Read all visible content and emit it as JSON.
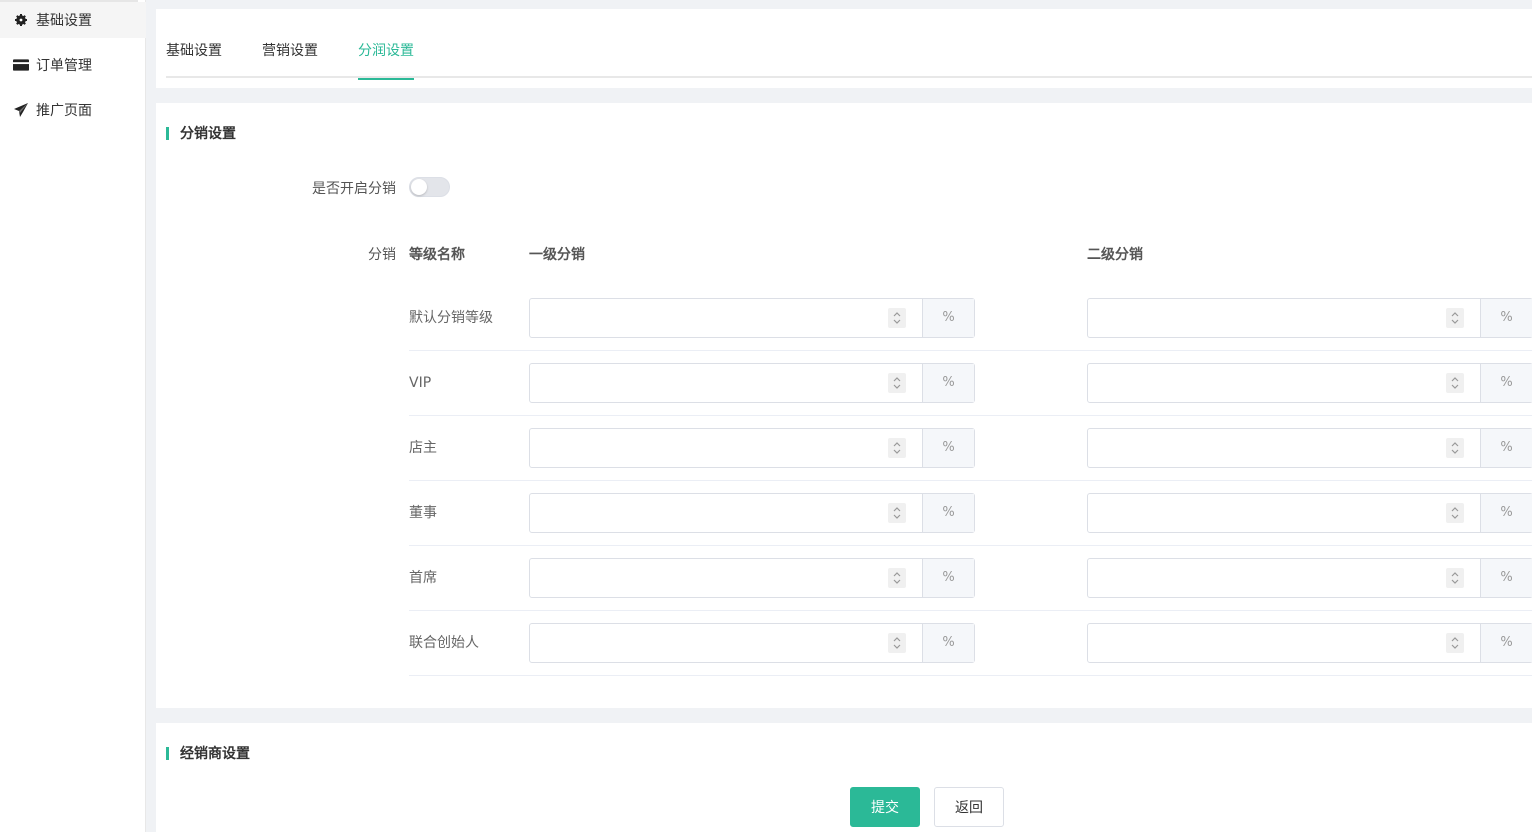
{
  "sidebar": {
    "items": [
      {
        "label": "基础设置",
        "icon": "gear-icon"
      },
      {
        "label": "订单管理",
        "icon": "card-icon"
      },
      {
        "label": "推广页面",
        "icon": "paper-plane-icon"
      }
    ]
  },
  "tabs": [
    {
      "label": "基础设置"
    },
    {
      "label": "营销设置"
    },
    {
      "label": "分润设置"
    }
  ],
  "distribution": {
    "section_title": "分销设置",
    "enable_label": "是否开启分销",
    "enable_value": false,
    "table_label": "分销",
    "col_name": "等级名称",
    "col_level1": "一级分销",
    "col_level2": "二级分销",
    "unit": "%",
    "rows": [
      {
        "name": "默认分销等级",
        "level1": "",
        "level2": ""
      },
      {
        "name": "VIP",
        "level1": "",
        "level2": ""
      },
      {
        "name": "店主",
        "level1": "",
        "level2": ""
      },
      {
        "name": "董事",
        "level1": "",
        "level2": ""
      },
      {
        "name": "首席",
        "level1": "",
        "level2": ""
      },
      {
        "name": "联合创始人",
        "level1": "",
        "level2": ""
      }
    ]
  },
  "dealer": {
    "section_title": "经销商设置"
  },
  "actions": {
    "submit": "提交",
    "back": "返回"
  },
  "colors": {
    "accent": "#2bb997"
  }
}
